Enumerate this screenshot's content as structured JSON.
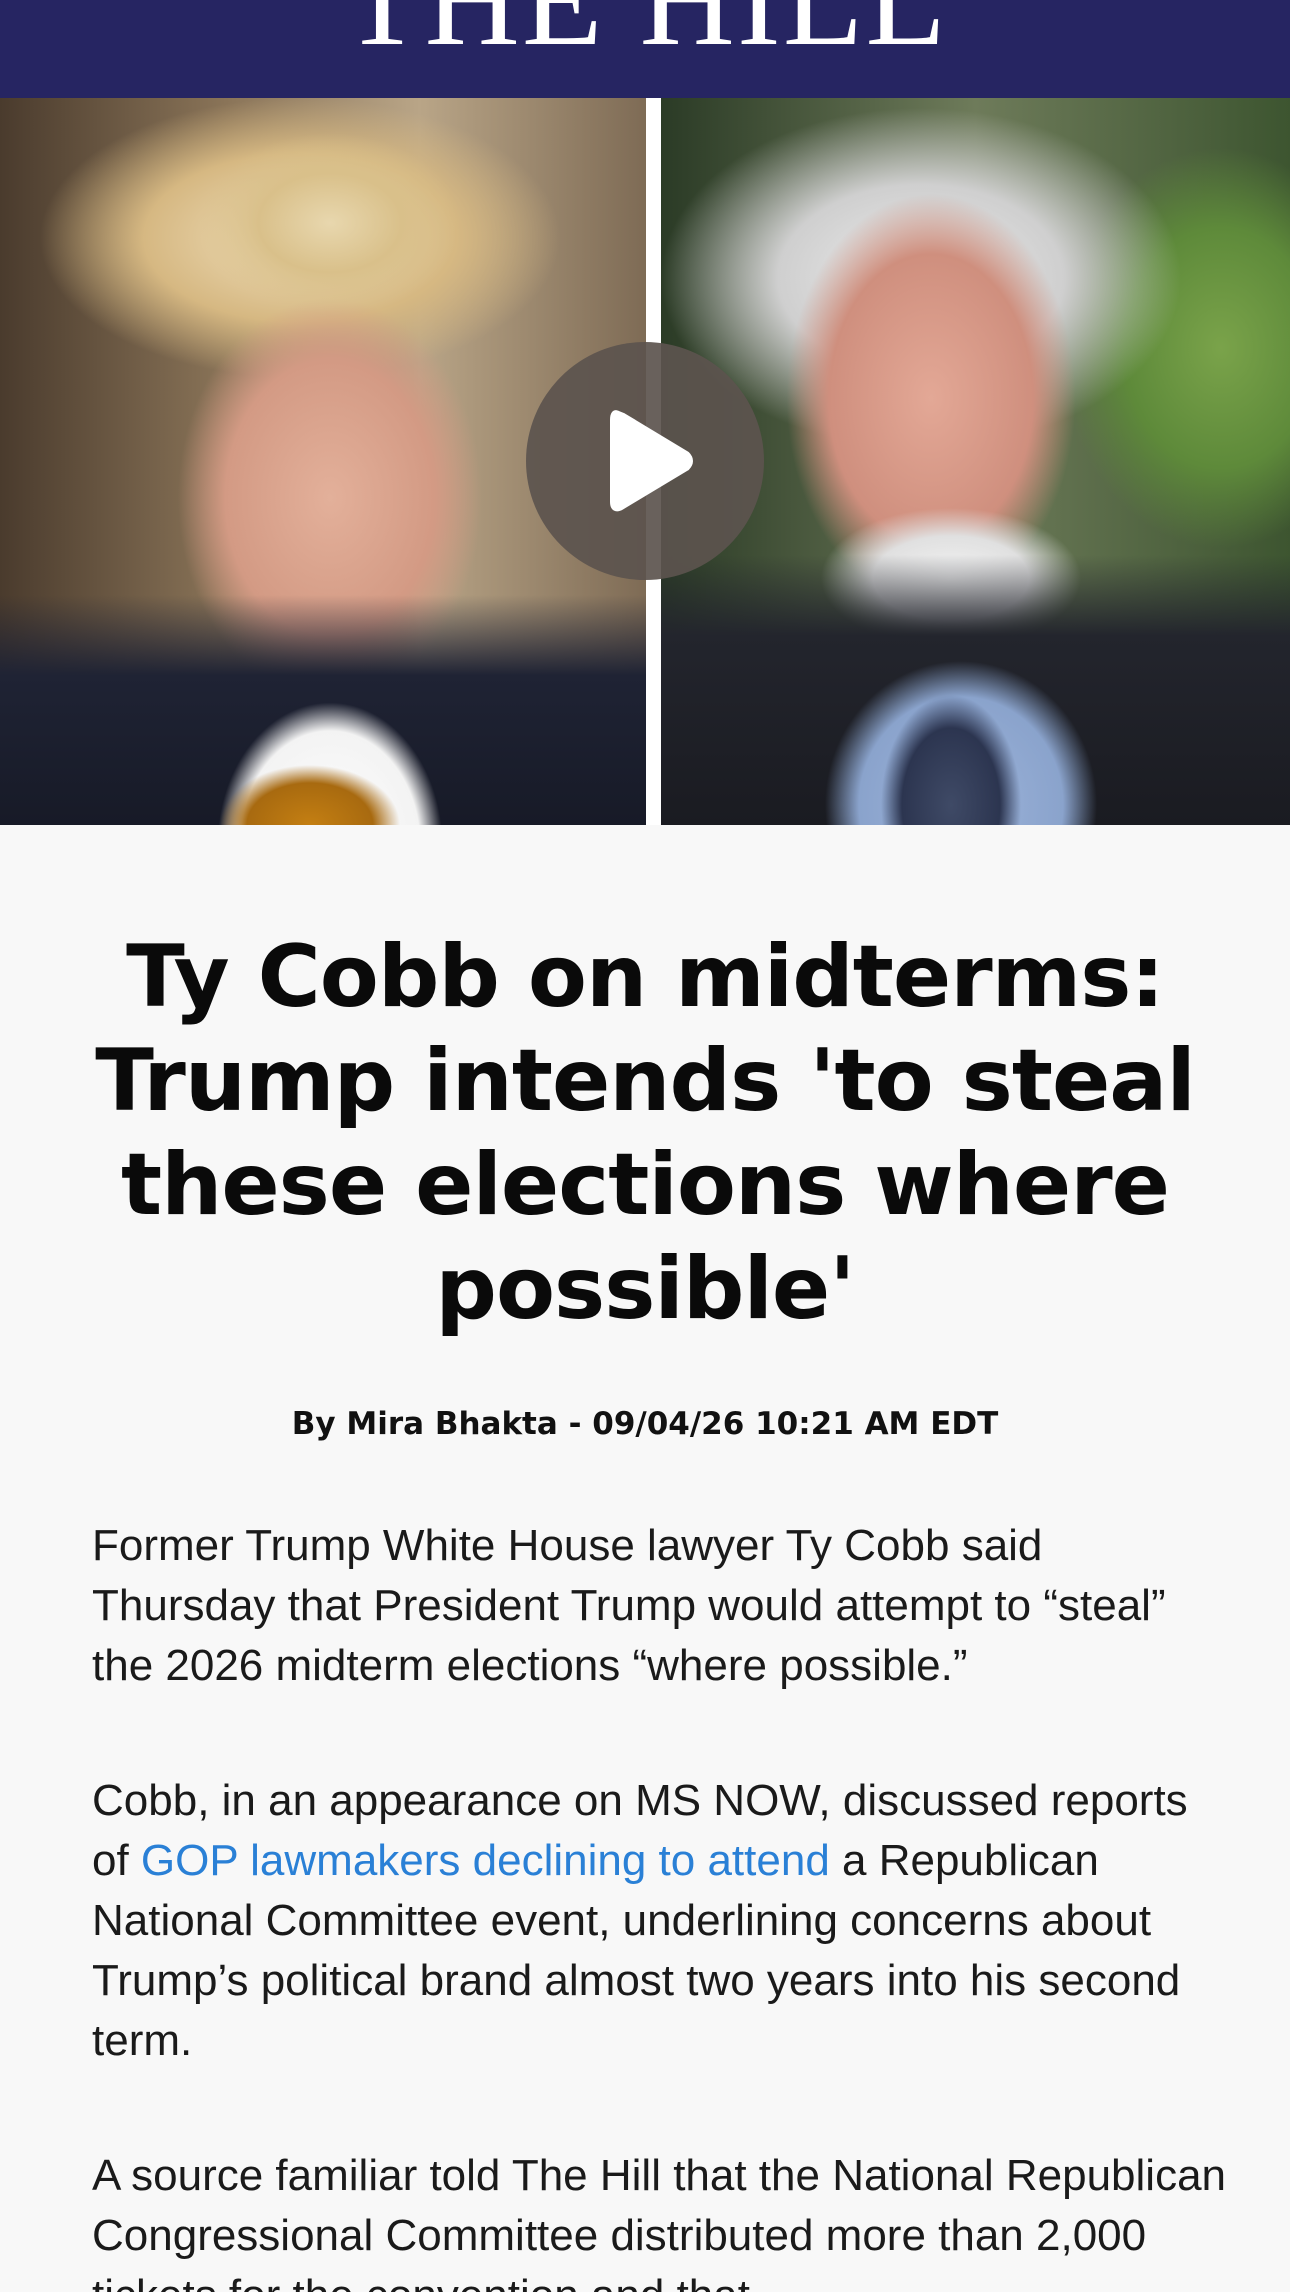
{
  "header": {
    "logo_text": "THE HILL"
  },
  "hero": {
    "left_photo_label": "Photo of Donald Trump",
    "right_photo_label": "Photo of Ty Cobb",
    "play_icon": "play-icon"
  },
  "article": {
    "headline": "Ty Cobb on midterms: Trump intends 'to steal these elections where possible'",
    "byline": "By Mira Bhakta - 09/04/26 10:21 AM EDT",
    "paragraphs": [
      {
        "text": "Former Trump White House lawyer Ty Cobb said Thursday that President Trump would attempt to “steal” the 2026 midterm elections “where possible.”"
      },
      {
        "before_link": "Cobb, in an appearance on MS NOW, discussed reports of ",
        "link_text": "GOP lawmakers declining to attend",
        "after_link": " a Republican National Committee event, underlining concerns about Trump’s political brand almost two years into his second term."
      },
      {
        "text": "A source familiar told The Hill that the National Republican Congressional Committee distributed more than 2,000 tickets for the convention and that"
      }
    ]
  },
  "colors": {
    "masthead": "#262562",
    "link": "#2a80d6",
    "background": "#f8f8f8"
  }
}
